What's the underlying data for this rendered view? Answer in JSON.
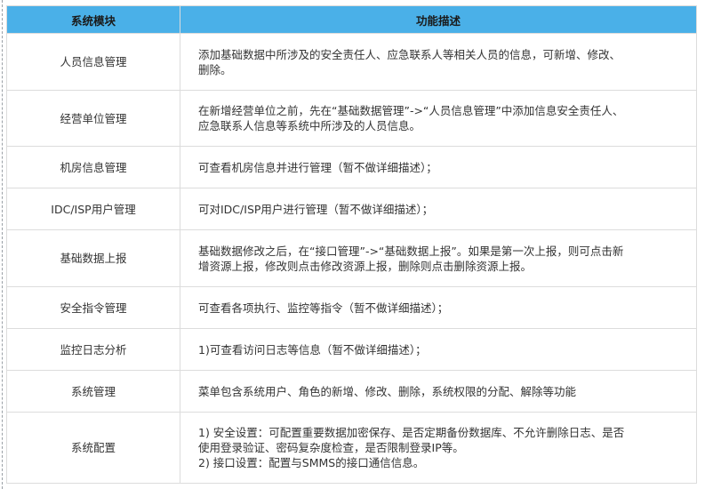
{
  "table": {
    "headers": [
      "系统模块",
      "功能描述"
    ],
    "rows": [
      {
        "module": "人员信息管理",
        "desc": [
          "添加基础数据中所涉及的安全责任人、应急联系人等相关人员的信息，可新增、修改、",
          "删除。"
        ]
      },
      {
        "module": "经营单位管理",
        "desc": [
          "在新增经营单位之前，先在“基础数据管理”->“人员信息管理”中添加信息安全责任人、",
          "应急联系人信息等系统中所涉及的人员信息。"
        ]
      },
      {
        "module": "机房信息管理",
        "desc": [
          "可查看机房信息并进行管理（暂不做详细描述）；"
        ]
      },
      {
        "module": "IDC/ISP用户管理",
        "desc": [
          "可对IDC/ISP用户进行管理（暂不做详细描述）；"
        ]
      },
      {
        "module": "基础数据上报",
        "desc": [
          "基础数据修改之后，在“接口管理”->“基础数据上报”。如果是第一次上报，则可点击新",
          "增资源上报，修改则点击修改资源上报，删除则点击删除资源上报。"
        ]
      },
      {
        "module": "安全指令管理",
        "desc": [
          "可查看各项执行、监控等指令（暂不做详细描述）；"
        ]
      },
      {
        "module": "监控日志分析",
        "desc": [
          "1)可查看访问日志等信息（暂不做详细描述）；"
        ]
      },
      {
        "module": "系统管理",
        "desc": [
          "菜单包含系统用户、角色的新增、修改、删除，系统权限的分配、解除等功能"
        ]
      },
      {
        "module": "系统配置",
        "desc": [
          "1) 安全设置：可配置重要数据加密保存、是否定期备份数据库、不允许删除日志、是否",
          "使用登录验证、密码复杂度检查，是否限制登录IP等。",
          "2) 接口设置：配置与SMMS的接口通信信息。"
        ]
      }
    ]
  },
  "colors": {
    "header_bg": "#4ab0e8",
    "border": "#dcdcdc",
    "text": "#333333"
  }
}
